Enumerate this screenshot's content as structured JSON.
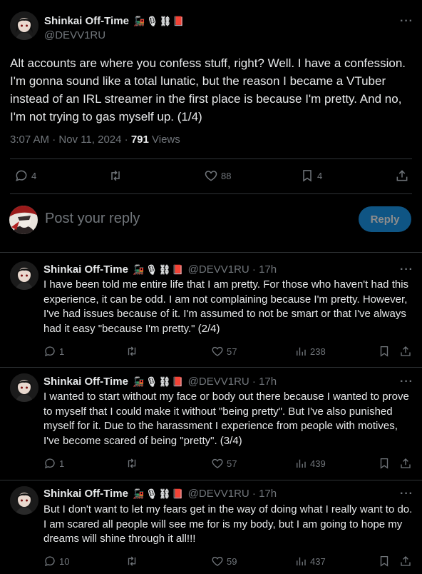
{
  "main_post": {
    "author_name": "Shinkai Off-Time",
    "author_handle": "@DEVV1RU",
    "name_emojis": [
      "🚂",
      "🎙",
      "⛓",
      "📕"
    ],
    "text": "Alt accounts are where you confess stuff, right? Well. I have a confession. I'm gonna sound like a total lunatic, but the reason I became a VTuber instead of an IRL streamer in the first place is because I'm pretty. And no, I'm not trying to gas myself up. (1/4)",
    "timestamp": "3:07 AM · Nov 11, 2024 · ",
    "views_count": "791",
    "views_label": " Views",
    "replies": "4",
    "likes": "88",
    "bookmarks": "4"
  },
  "composer": {
    "placeholder": "Post your reply",
    "reply_button": "Reply"
  },
  "replies": [
    {
      "author_name": "Shinkai Off-Time",
      "handle_time": "@DEVV1RU · 17h",
      "text": "I have been told me entire life that I am pretty. For those who haven't had this experience, it can be odd. I am not complaining because I'm pretty. However, I've had issues because of it. I'm assumed to not be smart or that I've always had it easy \"because I'm pretty.\" (2/4)",
      "replies": "1",
      "likes": "57",
      "views": "238"
    },
    {
      "author_name": "Shinkai Off-Time",
      "handle_time": "@DEVV1RU · 17h",
      "text": "I wanted to start without my face or body out there because I wanted to prove to myself that I could make it without \"being pretty\". But I've also punished myself for it. Due to the harassment I experience from people with motives, I've become scared of being \"pretty\". (3/4)",
      "replies": "1",
      "likes": "57",
      "views": "439"
    },
    {
      "author_name": "Shinkai Off-Time",
      "handle_time": "@DEVV1RU · 17h",
      "text": "But I don't want to let my fears get in the way of doing what I really want to do. I am scared all people will see me for is my body, but I am going to hope my dreams will shine through it all!!!",
      "replies": "10",
      "likes": "59",
      "views": "437"
    }
  ],
  "colors": {
    "background": "#000000",
    "text": "#e7e9ea",
    "muted": "#71767b",
    "divider": "#2f3336",
    "accent": "#1d9bf0"
  }
}
